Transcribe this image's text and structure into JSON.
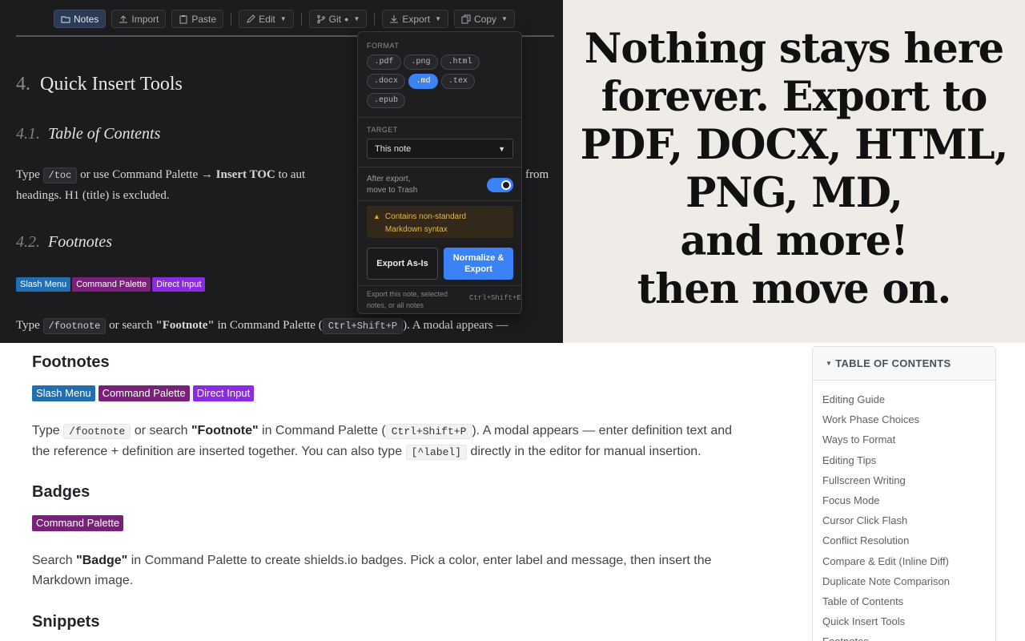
{
  "toolbar": {
    "notes": "Notes",
    "import": "Import",
    "paste": "Paste",
    "edit": "Edit",
    "git": "Git",
    "git_dot": "●",
    "export": "Export",
    "copy": "Copy"
  },
  "dark_doc": {
    "h2_num": "4.",
    "h2_text": "Quick Insert Tools",
    "h3a_num": "4.1.",
    "h3a_text": "Table of Contents",
    "toc_p1_pre": "Type",
    "toc_code": "/toc",
    "toc_p1_mid": "or use Command Palette →",
    "toc_p1_bold": "Insert TOC",
    "toc_p1_post": "to aut",
    "toc_p1_right": "from",
    "toc_p2": "headings. H1 (title) is excluded.",
    "h3b_num": "4.2.",
    "h3b_text": "Footnotes",
    "badges": [
      "Slash Menu",
      "Command Palette",
      "Direct Input"
    ],
    "fn_pre": "Type",
    "fn_code": "/footnote",
    "fn_mid": "or search",
    "fn_bold": "\"Footnote\"",
    "fn_mid2": "in Command Palette (",
    "fn_kbd": "Ctrl+Shift+P",
    "fn_post": "). A modal appears —"
  },
  "export_menu": {
    "format_label": "FORMAT",
    "formats": [
      ".pdf",
      ".png",
      ".html",
      ".docx",
      ".md",
      ".tex",
      ".epub"
    ],
    "selected_format": ".md",
    "target_label": "TARGET",
    "target_value": "This note",
    "trash_label_1": "After export,",
    "trash_label_2": "move to Trash",
    "trash_toggle": "on",
    "warning_1": "Contains non-standard",
    "warning_2": "Markdown syntax",
    "btn_as_is": "Export As-Is",
    "btn_normalize_1": "Normalize &",
    "btn_normalize_2": "Export",
    "footer_1": "Export this note, selected",
    "footer_2": "notes, or all notes",
    "shortcut": "Ctrl+Shift+E"
  },
  "promo": {
    "lines": [
      "Nothing stays here",
      "forever. Export to",
      "PDF, DOCX, HTML,",
      "PNG, MD,",
      "and more!",
      "then move on."
    ]
  },
  "light_doc": {
    "footnotes_heading": "Footnotes",
    "footnotes_badges": [
      "Slash Menu",
      "Command Palette",
      "Direct Input"
    ],
    "fn_type": "Type",
    "fn_code": "/footnote",
    "fn_or": "or search",
    "fn_bold": "\"Footnote\"",
    "fn_in": "in Command Palette (",
    "fn_kbd": "Ctrl+Shift+P",
    "fn_rest1": "). A modal appears — enter definition text and",
    "fn_rest2": "the reference + definition are inserted together. You can also type",
    "fn_code2": "[^label]",
    "fn_rest3": "directly in the editor for manual insertion.",
    "badges_heading": "Badges",
    "badges_badge": "Command Palette",
    "bd_search": "Search",
    "bd_bold": "\"Badge\"",
    "bd_rest1": "in Command Palette to create shields.io badges. Pick a color, enter label and message, then insert the",
    "bd_rest2": "Markdown image.",
    "snippets_heading": "Snippets"
  },
  "toc": {
    "title": "TABLE OF CONTENTS",
    "items": [
      "Editing Guide",
      "Work Phase Choices",
      "Ways to Format",
      "Editing Tips",
      "Fullscreen Writing",
      "Focus Mode",
      "Cursor Click Flash",
      "Conflict Resolution",
      "Compare & Edit (Inline Diff)",
      "Duplicate Note Comparison",
      "Table of Contents",
      "Quick Insert Tools",
      "Footnotes"
    ]
  },
  "colors": {
    "accent_blue": "#3b82f6",
    "badge_slash": "#1f6fb2",
    "badge_palette": "#7a1f7a",
    "badge_direct": "#8a2be2"
  }
}
